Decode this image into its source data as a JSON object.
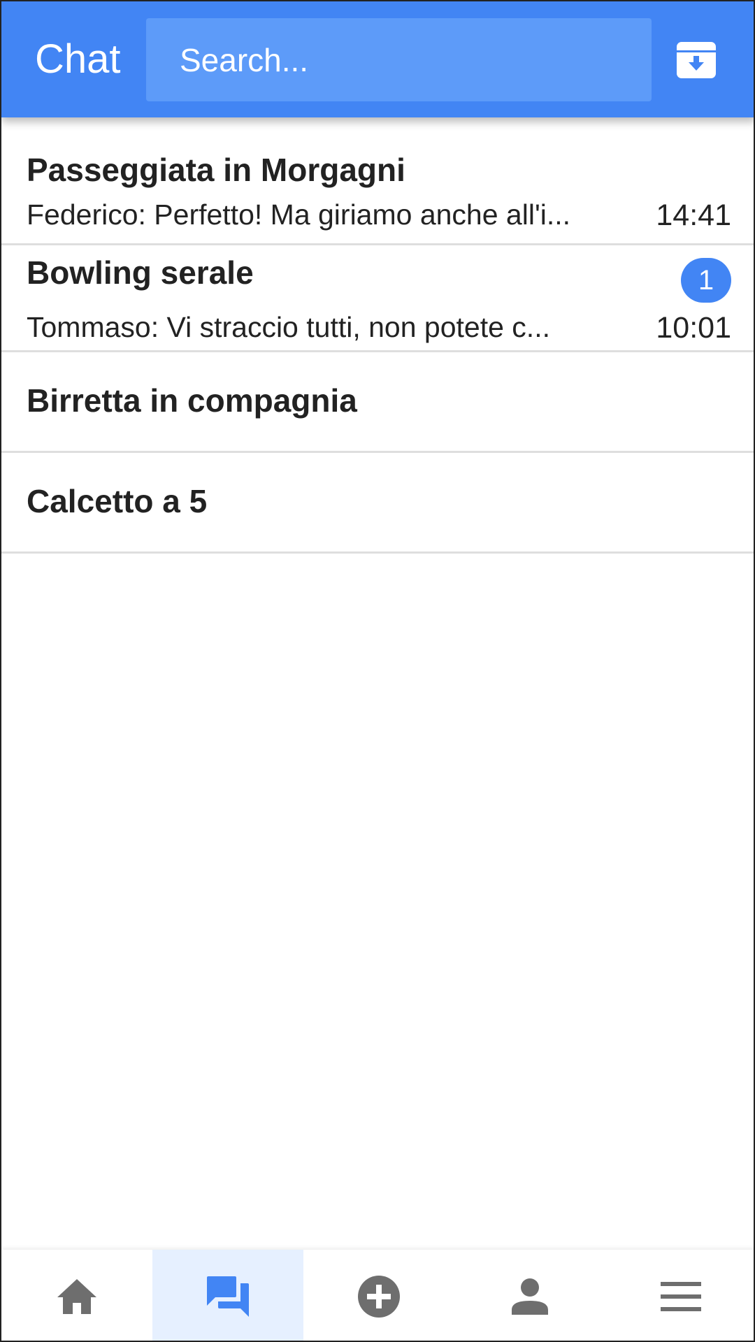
{
  "header": {
    "title": "Chat",
    "search_placeholder": "Search...",
    "archive_icon": "archive-download-icon",
    "background_color": "#4285f4"
  },
  "chats": [
    {
      "title": "Passeggiata in Morgagni",
      "preview": "Federico: Perfetto! Ma giriamo anche all'i...",
      "time": "14:41",
      "unread": ""
    },
    {
      "title": "Bowling serale",
      "preview": "Tommaso: Vi straccio tutti, non potete c...",
      "time": "10:01",
      "unread": "1"
    },
    {
      "title": "Birretta in compagnia",
      "preview": "",
      "time": "",
      "unread": ""
    },
    {
      "title": "Calcetto a 5",
      "preview": "",
      "time": "",
      "unread": ""
    }
  ],
  "bottom_nav": {
    "items": [
      {
        "icon": "home-icon",
        "active": false
      },
      {
        "icon": "chat-icon",
        "active": true
      },
      {
        "icon": "add-circle-icon",
        "active": false
      },
      {
        "icon": "person-icon",
        "active": false
      },
      {
        "icon": "menu-icon",
        "active": false
      }
    ],
    "active_color": "#4285f4",
    "inactive_color": "#6e6e6e",
    "active_background": "#e6f0ff"
  }
}
